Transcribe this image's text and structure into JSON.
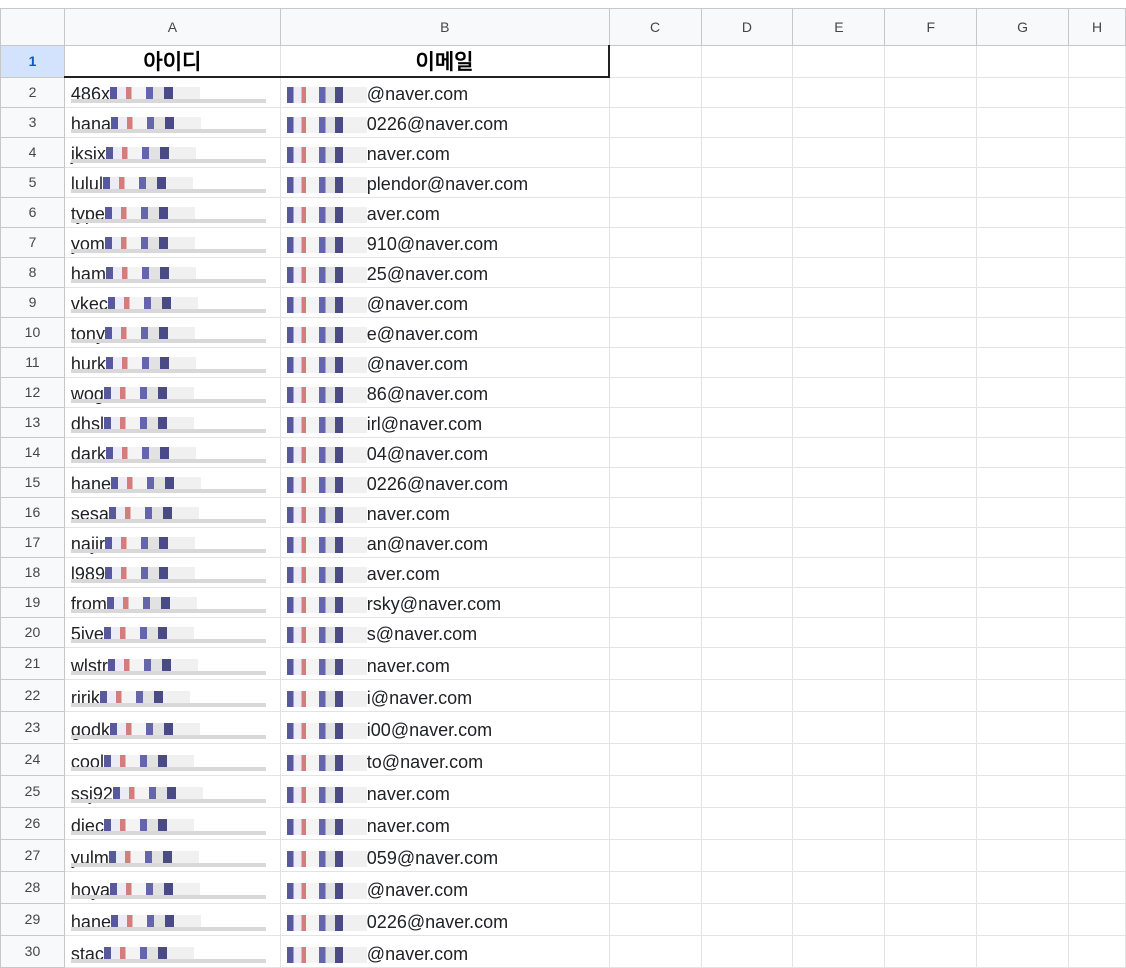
{
  "columns": [
    "A",
    "B",
    "C",
    "D",
    "E",
    "F",
    "G",
    "H"
  ],
  "header": {
    "row_number": "1",
    "col_a": "아이디",
    "col_b": "이메일"
  },
  "rows": [
    {
      "n": "2",
      "id": "486x",
      "email": "@naver.com"
    },
    {
      "n": "3",
      "id": "hana",
      "email": "0226@naver.com"
    },
    {
      "n": "4",
      "id": "jksix",
      "email": "naver.com"
    },
    {
      "n": "5",
      "id": "lulul",
      "email": "plendor@naver.com"
    },
    {
      "n": "6",
      "id": "type",
      "email": "aver.com"
    },
    {
      "n": "7",
      "id": "yom",
      "email": "910@naver.com"
    },
    {
      "n": "8",
      "id": "ham",
      "email": "25@naver.com"
    },
    {
      "n": "9",
      "id": "vkec",
      "email": "@naver.com"
    },
    {
      "n": "10",
      "id": "tony",
      "email": "e@naver.com"
    },
    {
      "n": "11",
      "id": "hurk",
      "email": "@naver.com"
    },
    {
      "n": "12",
      "id": "wog",
      "email": "86@naver.com"
    },
    {
      "n": "13",
      "id": "dhsl",
      "email": "irl@naver.com"
    },
    {
      "n": "14",
      "id": "dark",
      "email": "04@naver.com"
    },
    {
      "n": "15",
      "id": "hane",
      "email": "0226@naver.com"
    },
    {
      "n": "16",
      "id": "sesa",
      "email": "naver.com"
    },
    {
      "n": "17",
      "id": "najir",
      "email": "an@naver.com"
    },
    {
      "n": "18",
      "id": "l989",
      "email": "aver.com"
    },
    {
      "n": "19",
      "id": "from",
      "email": "rsky@naver.com"
    },
    {
      "n": "20",
      "id": "5ive",
      "email": "s@naver.com"
    },
    {
      "n": "21",
      "id": "wlstr",
      "email": "naver.com"
    },
    {
      "n": "22",
      "id": "ririk",
      "email": "i@naver.com"
    },
    {
      "n": "23",
      "id": "godk",
      "email": "i00@naver.com"
    },
    {
      "n": "24",
      "id": "cool",
      "email": "to@naver.com"
    },
    {
      "n": "25",
      "id": "ssj92",
      "email": "naver.com"
    },
    {
      "n": "26",
      "id": "diec",
      "email": "naver.com"
    },
    {
      "n": "27",
      "id": "yulm",
      "email": "059@naver.com"
    },
    {
      "n": "28",
      "id": "hoya",
      "email": "@naver.com"
    },
    {
      "n": "29",
      "id": "hane",
      "email": "0226@naver.com"
    },
    {
      "n": "30",
      "id": "stac",
      "email": "@naver.com"
    }
  ]
}
